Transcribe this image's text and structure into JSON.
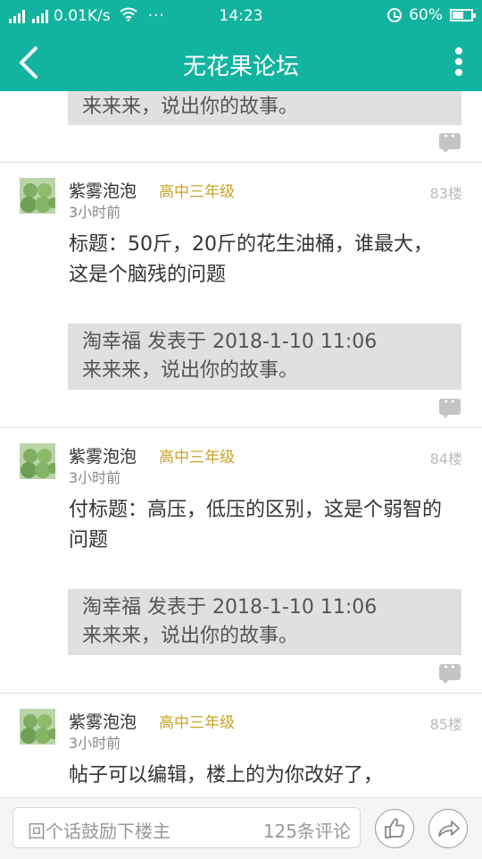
{
  "status_bar": {
    "speed": "0.01K/s",
    "dots": "···",
    "time": "14:23",
    "battery": "60%",
    "battery_level": 0.6
  },
  "app_bar": {
    "title": "无花果论坛",
    "back_icon": "chevron-left-icon",
    "more_icon": "more-vertical-icon"
  },
  "top_quote": {
    "text": "来来来，说出你的故事。"
  },
  "posts": [
    {
      "user": "紫雾泡泡",
      "level": "高中三年级",
      "floor": "83楼",
      "time": "3小时前",
      "text": "标题：50斤，20斤的花生油桶，谁最大，这是个脑残的问题",
      "quote_header": "淘幸福 发表于 2018-1-10 11:06",
      "quote_text": "来来来，说出你的故事。"
    },
    {
      "user": "紫雾泡泡",
      "level": "高中三年级",
      "floor": "84楼",
      "time": "3小时前",
      "text": "付标题：高压，低压的区别，这是个弱智的问题",
      "quote_header": "淘幸福 发表于 2018-1-10 11:06",
      "quote_text": "来来来，说出你的故事。"
    },
    {
      "user": "紫雾泡泡",
      "level": "高中三年级",
      "floor": "85楼",
      "time": "3小时前",
      "text": "帖子可以编辑，楼上的为你改好了，"
    }
  ],
  "bottom_bar": {
    "placeholder": "回个话鼓励下楼主",
    "comment_count": "125条评论",
    "like_icon": "thumbs-up-icon",
    "share_icon": "share-icon"
  },
  "colors": {
    "accent": "#13b49f",
    "level": "#c9a227",
    "quote_bg": "#e0e0e0"
  }
}
